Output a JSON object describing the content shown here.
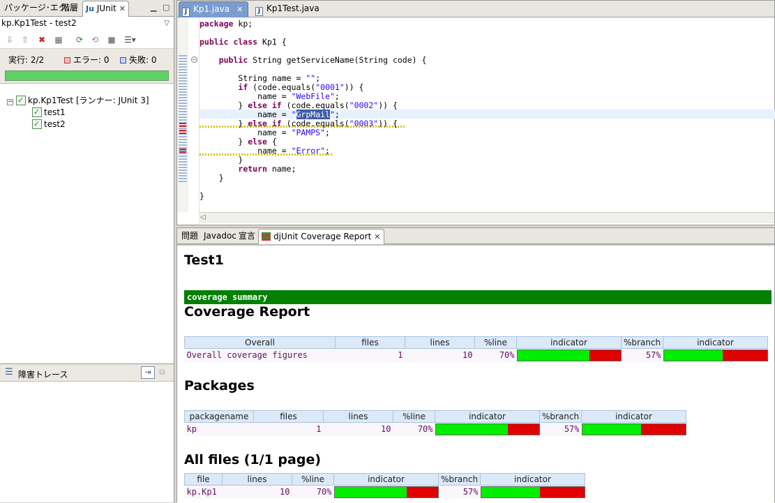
{
  "left": {
    "tabs": [
      {
        "label": "パッケージ･エク..."
      },
      {
        "label": "階層"
      },
      {
        "label": "JUnit"
      }
    ],
    "junit_title": "kp.Kp1Test - test2",
    "counters": {
      "runs": "実行:  2/2",
      "errors": "エラー:  0",
      "failures": "失敗:  0"
    },
    "progress": 1.0,
    "tree": {
      "root": "kp.Kp1Test [ランナー: JUnit 3]",
      "children": [
        "test1",
        "test2"
      ]
    },
    "trace_title": "障害トレース"
  },
  "editor": {
    "tabs": [
      {
        "label": "Kp1.java"
      },
      {
        "label": "Kp1Test.java"
      }
    ],
    "lines": [
      "package kp;",
      "",
      "public class Kp1 {",
      "",
      "    public String getServiceName(String code) {",
      "",
      "        String name = \"\";",
      "        if (code.equals(\"0001\")) {",
      "            name = \"WebFile\";",
      "        } else if (code.equals(\"0002\")) {",
      "            name = \"GrpMail\";",
      "        } else if (code.equals(\"0003\")) {",
      "            name = \"PAMPS\";",
      "        } else {",
      "            name = \"Error\";",
      "        }",
      "        return name;",
      "    }",
      "",
      "}"
    ]
  },
  "bottom": {
    "tabs": [
      {
        "label": "問題"
      },
      {
        "label": "Javadoc"
      },
      {
        "label": "宣言"
      },
      {
        "label": "djUnit Coverage Report"
      }
    ]
  },
  "report": {
    "title": "Test1",
    "summary_bar": "coverage summary",
    "coverage_heading": "Coverage Report",
    "packages_heading": "Packages",
    "allfiles_heading": "All files (1/1 page)",
    "overall": {
      "headers": [
        "Overall",
        "files",
        "lines",
        "%line",
        "indicator",
        "%branch",
        "indicator"
      ],
      "row": {
        "name": "Overall coverage figures",
        "files": "1",
        "lines": "10",
        "line_pct": "70%",
        "line_frac": 0.7,
        "branch_pct": "57%",
        "branch_frac": 0.57
      }
    },
    "packages": {
      "headers": [
        "packagename",
        "files",
        "lines",
        "%line",
        "indicator",
        "%branch",
        "indicator"
      ],
      "row": {
        "name": "kp",
        "files": "1",
        "lines": "10",
        "line_pct": "70%",
        "line_frac": 0.7,
        "branch_pct": "57%",
        "branch_frac": 0.57
      }
    },
    "files": {
      "headers": [
        "file",
        "lines",
        "%line",
        "indicator",
        "%branch",
        "indicator"
      ],
      "row": {
        "name": "kp.Kp1",
        "lines": "10",
        "line_pct": "70%",
        "line_frac": 0.7,
        "branch_pct": "57%",
        "branch_frac": 0.57
      }
    }
  },
  "colors": {
    "covered": "#00ee00",
    "uncovered": "#e00000",
    "summary_bar": "#008000",
    "progress_ok": "#5fd065"
  }
}
